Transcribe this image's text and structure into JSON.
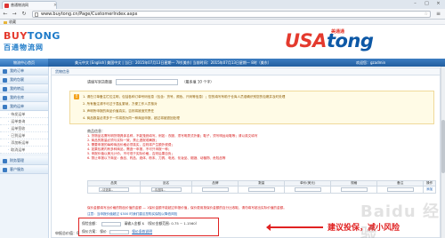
{
  "browser": {
    "tab_title": "普通物流网",
    "url": "www.buytong.cn/Page/CustomerIndex.aspx",
    "bookmark": "收藏"
  },
  "header": {
    "logo_left_en_a": "BUY",
    "logo_left_en_b": "TONG",
    "logo_left_cn": "百通物流网",
    "logo_right_a": "USA",
    "logo_right_b": "tong",
    "logo_right_cn": "美通通"
  },
  "sitebar": {
    "current": "物流中心首页",
    "info": "美元中文 [English] 美国中文 | 当日：2015年07月13日星期一 7时(美东)  当前时间：2015年07月13日星期一 8时（美东）",
    "user": "欢迎您：gzadmin"
  },
  "sidebar": {
    "items": [
      {
        "type": "head",
        "label": "我的订单"
      },
      {
        "type": "head",
        "label": "我的包裹"
      },
      {
        "type": "head",
        "label": "我的转运"
      },
      {
        "type": "head",
        "label": "我的仓库"
      },
      {
        "type": "head",
        "label": "我的运单"
      },
      {
        "type": "sub",
        "label": "待发运单"
      },
      {
        "type": "sub",
        "label": "运单查询"
      },
      {
        "type": "sub",
        "label": "运单签收"
      },
      {
        "type": "sub",
        "label": "已到运单"
      },
      {
        "type": "sub",
        "label": "添加新运单"
      },
      {
        "type": "sub",
        "label": "取消运单"
      },
      {
        "type": "head",
        "label": "财务管理"
      },
      {
        "type": "head",
        "label": "客户服务"
      }
    ]
  },
  "main": {
    "title": "货物信息",
    "input_label": "请填写到货数量",
    "input_hint": "（最多填 10 个字）",
    "notes": [
      "1. 请在订单备注栏位注明，包括各种订单号码信息（包含：货号、颜色、尺码等信息）；您的填写有助于仓库人员准确识别您的包裹并及时处理",
      "2. 所有备注请不可过于混乱繁琐，方便工作人员核对",
      "3. 声明所申报的商品价值真实，否则将被追究责任",
      "4. 商品数量必须多于一件将视为同一种商品申报，超过将被退回处理"
    ],
    "goods_label": "商品信息：",
    "goods_requirements": [
      "1. 货物品名需写明货物具体名称，不能笼统填写。例如：衣服，须写明男式外套；鞋子，须写明运动鞋等；请以英文填写",
      "2. 商品的数量必须与实际一致，禁止虚报或瞒报；",
      "3. 需要申报的每种商品价格必须真实，否则将产生额外税费；",
      "4. 如果包裹内有多种商品，需逐一申报，不可只申报一种；",
      "5. 申报价值以美元计价，不可低于实际价格，否则后果自负；",
      "6. 禁止申报以下商品：食品、药品、液体、粉末、刀具、电池、化妆品、烟酒、动植物、危险品等"
    ],
    "table": {
      "headers": [
        "品类",
        "品名",
        "品牌",
        "数量",
        "单价(美元)",
        "规格",
        "备注",
        "操作"
      ],
      "row": {
        "category": "--请选择--",
        "name": "--请选择--",
        "action": "添加"
      }
    },
    "insurance_note": "保价金额填写出价格的物品价值的金额 — 1保价金额不能超过申报价值，保价费用按保价金额的百分比收取，请勿填写超出实际价值的金额。",
    "insurance_note2": "注意：当申报价值超过 $300 时我们建议您购买保险以降低风险",
    "insurance": {
      "row1_label": "保险金额：",
      "row1_value": "请输入金额",
      "row1_unit": "$",
      "row1_fee": "（保价金额范围: 0.75 ~ 1.1560）",
      "row2_label": "保价方案：",
      "row2_value": "保价",
      "row2_link": "保价条款说明"
    },
    "bottom_label": "申报总价值：0"
  },
  "annotation": {
    "text": "建议投保，减小风险"
  },
  "watermark": "Baidu 经验",
  "colors": {
    "brand_blue": "#1d7ac8",
    "brand_red": "#e43a2e",
    "annotation_red": "#e02222",
    "nav_blue": "#215e9f"
  }
}
